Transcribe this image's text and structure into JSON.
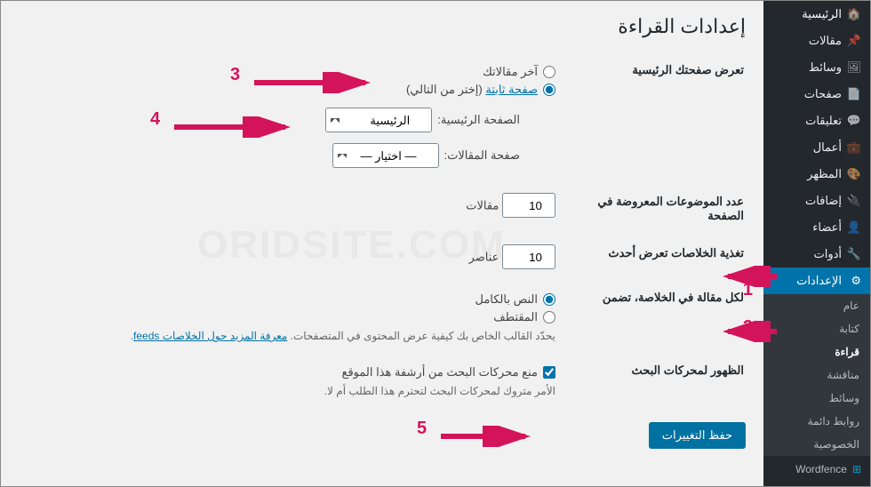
{
  "sidebar": {
    "home": "الرئيسية",
    "items": [
      "مقالات",
      "وسائط",
      "صفحات",
      "تعليقات",
      "أعمال",
      "المظهر",
      "إضافات",
      "أعضاء",
      "أدوات"
    ],
    "settings": "الإعدادات",
    "sub": [
      "عام",
      "كتابة",
      "قراءة",
      "مناقشة",
      "وسائط",
      "روابط دائمة",
      "الخصوصية"
    ],
    "wordfence": "Wordfence"
  },
  "page": {
    "title": "إعدادات القراءة",
    "homepage_label": "تعرض صفحتك الرئيسية",
    "opt_latest": "آخر مقالاتك",
    "opt_static_pre": "صفحة ثابتة",
    "opt_static_post": " (إختر من التالي)",
    "homepage_sel_label": "الصفحة الرئيسية:",
    "homepage_sel_value": "الرئيسية",
    "posts_sel_label": "صفحة المقالات:",
    "posts_sel_value": "— اختيار —",
    "posts_per_page_label": "عدد الموضوعات المعروضة في الصفحة",
    "posts_per_page_value": "10",
    "posts_per_page_unit": "مقالات",
    "feed_items_label": "تغذية الخلاصات تعرض أحدث",
    "feed_items_value": "10",
    "feed_items_unit": "عناصر",
    "feed_content_label": "لكل مقالة في الخلاصة، تضمن",
    "feed_full": "النص بالكامل",
    "feed_summary": "المقتطف",
    "feed_desc_pre": "يحدّد القالب الخاص بك كيفية عرض المحتوى في المتصفحات. ",
    "feed_desc_link": "معرفة المزيد حول الخلاصات feeds",
    "seo_label": "الظهور لمحركات البحث",
    "seo_checkbox": "منع محركات البحث من أرشفة هذا الموقع",
    "seo_desc": "الأمر متروك لمحركات البحث لتحترم هذا الطلب أم لا.",
    "save": "حفظ التغييرات"
  },
  "annotations": {
    "n1": "1",
    "n2": "2",
    "n3": "3",
    "n4": "4",
    "n5": "5"
  }
}
